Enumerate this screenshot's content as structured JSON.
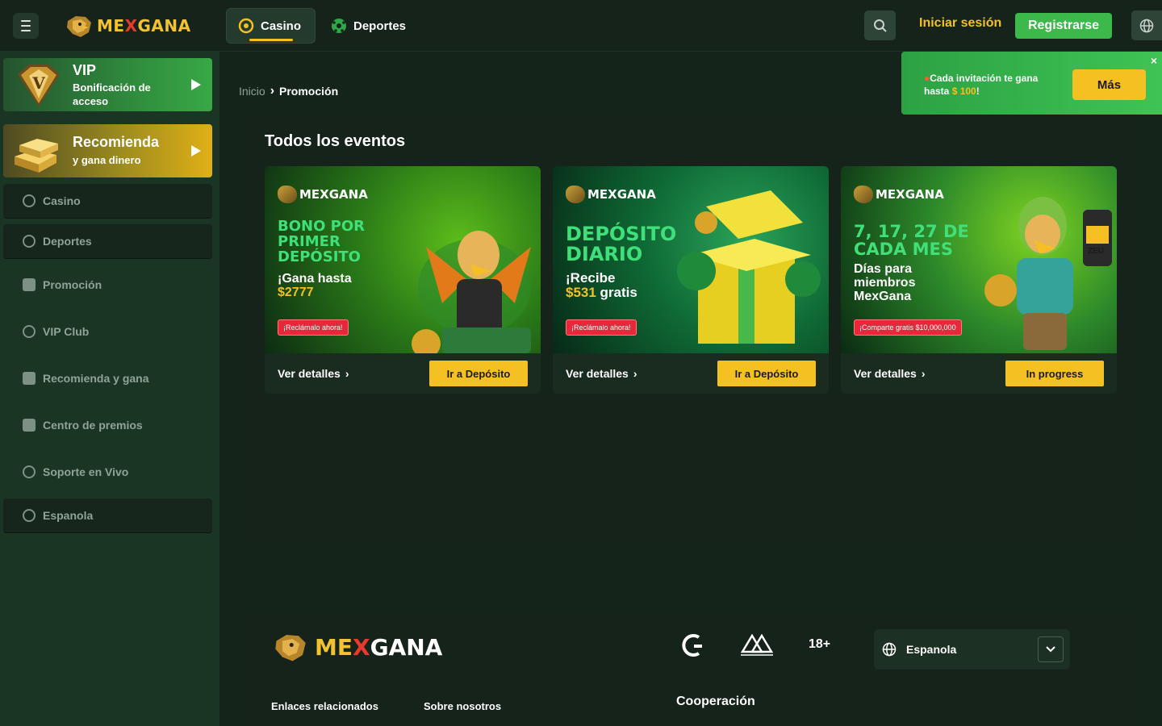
{
  "header": {
    "brand": {
      "part1": "ME",
      "part2": "X",
      "part3": "GANA"
    },
    "tabs": [
      {
        "label": "Casino",
        "active": true
      },
      {
        "label": "Deportes",
        "active": false
      }
    ],
    "login_label": "Iniciar sesión",
    "register_label": "Registrarse"
  },
  "sidebar": {
    "vip": {
      "title": "VIP",
      "subtitle": "Bonificación de acceso"
    },
    "recommend": {
      "title": "Recomienda",
      "subtitle": "y gana dinero"
    },
    "items": [
      {
        "label": "Casino",
        "icon": "casino-chip-icon"
      },
      {
        "label": "Deportes",
        "icon": "soccer-ball-icon"
      },
      {
        "label": "Promoción",
        "icon": "gift-icon"
      },
      {
        "label": "VIP Club",
        "icon": "medal-icon"
      },
      {
        "label": "Recomienda y gana",
        "icon": "users-icon"
      },
      {
        "label": "Centro de premios",
        "icon": "calendar-gift-icon"
      },
      {
        "label": "Soporte en Vivo",
        "icon": "headset-icon"
      },
      {
        "label": "Espanola",
        "icon": "globe-icon"
      }
    ]
  },
  "breadcrumb": {
    "home": "Inicio",
    "current": "Promoción"
  },
  "section_title": "Todos los eventos",
  "cards": [
    {
      "brand": "MEXGANA",
      "headline": [
        "BONO POR",
        "PRIMER",
        "DEPÓSITO"
      ],
      "sub_line1": "¡Gana hasta",
      "sub_line2": "$2777",
      "cta": "¡Reclámalo ahora!",
      "details_label": "Ver detalles",
      "action_label": "Ir a Depósito"
    },
    {
      "brand": "MEXGANA",
      "headline": [
        "DEPÓSITO",
        "DIARIO"
      ],
      "sub_line1": "¡Recibe",
      "sub_amount": "$531",
      "sub_suffix": " gratis",
      "cta": "¡Reclámalo ahora!",
      "details_label": "Ver detalles",
      "action_label": "Ir a Depósito"
    },
    {
      "brand": "MEXGANA",
      "headline": [
        "7, 17, 27 DE",
        "CADA MES"
      ],
      "sub_lines": [
        "Días para",
        "miembros",
        "MexGana"
      ],
      "cta": "¡Comparte gratis $10,000,000",
      "details_label": "Ver detalles",
      "action_label": "In progress",
      "slot_text": "ZEU"
    }
  ],
  "toast": {
    "text_prefix": "Cada invitación te gana hasta ",
    "amount": "$ 100",
    "text_suffix": "!",
    "button_label": "Más",
    "close": "×"
  },
  "footer": {
    "age_label": "18+",
    "language_label": "Espanola",
    "links": [
      "Enlaces relacionados",
      "Sobre nosotros"
    ],
    "cooperation": "Cooperación"
  },
  "colors": {
    "accent_yellow": "#f5c022",
    "accent_green": "#3db84a",
    "bg_dark": "#14241a"
  }
}
